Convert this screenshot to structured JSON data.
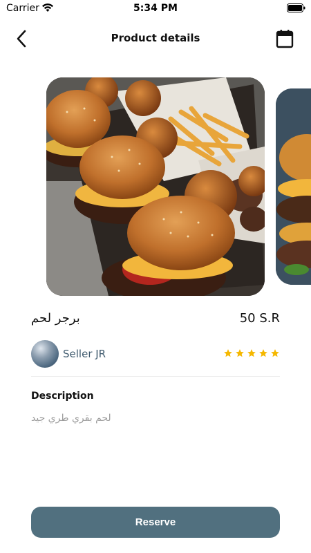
{
  "status_bar": {
    "carrier": "Carrier",
    "time": "5:34 PM"
  },
  "nav": {
    "title": "Product details"
  },
  "product": {
    "name": "برجر لحم",
    "price": "50 S.R",
    "rating": 5,
    "rating_max": 5
  },
  "seller": {
    "name": "Seller JR"
  },
  "description": {
    "label": "Description",
    "text": "لحم بقري طري جيد"
  },
  "actions": {
    "reserve_label": "Reserve"
  },
  "colors": {
    "accent": "#51707f",
    "star": "#f5b800",
    "seller_text": "#3f5a6e"
  }
}
